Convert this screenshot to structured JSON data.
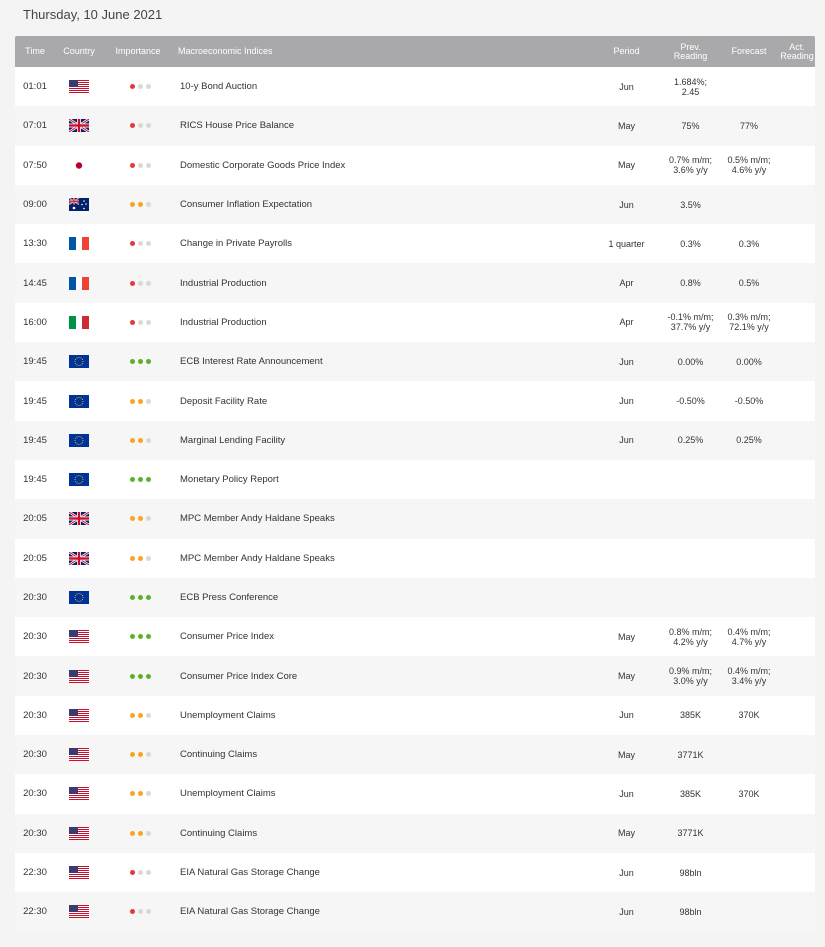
{
  "page": {
    "date": "Thursday, 10 June 2021"
  },
  "colors": {
    "high": "#5cb12c",
    "medium": "#f5a623",
    "low": "#e03a3a",
    "inactive": "#d8d8d8",
    "header_bg": "#a9a9ab"
  },
  "header": {
    "time": "Time",
    "country": "Country",
    "importance": "Importance",
    "indices": "Macroeconomic Indices",
    "period": "Period",
    "prev_1": "Prev.",
    "prev_2": "Reading",
    "forecast": "Forecast",
    "act_1": "Act.",
    "act_2": "Reading"
  },
  "rows": [
    {
      "time": "01:01",
      "country": "us",
      "importance": "low",
      "name": "10-y Bond Auction",
      "period": "Jun",
      "prev": [
        "1.684%;",
        "2.45"
      ],
      "forecast": [],
      "actual": ""
    },
    {
      "time": "07:01",
      "country": "gb",
      "importance": "low",
      "name": "RICS House Price Balance",
      "period": "May",
      "prev": [
        "75%"
      ],
      "forecast": [
        "77%"
      ],
      "actual": ""
    },
    {
      "time": "07:50",
      "country": "jp",
      "importance": "low",
      "name": "Domestic Corporate Goods Price Index",
      "period": "May",
      "prev": [
        "0.7% m/m;",
        "3.6% y/y"
      ],
      "forecast": [
        "0.5% m/m;",
        "4.6% y/y"
      ],
      "actual": ""
    },
    {
      "time": "09:00",
      "country": "au",
      "importance": "medium",
      "name": "Consumer Inflation Expectation",
      "period": "Jun",
      "prev": [
        "3.5%"
      ],
      "forecast": [],
      "actual": ""
    },
    {
      "time": "13:30",
      "country": "fr",
      "importance": "low",
      "name": "Change in Private Payrolls",
      "period": "1 quarter",
      "prev": [
        "0.3%"
      ],
      "forecast": [
        "0.3%"
      ],
      "actual": ""
    },
    {
      "time": "14:45",
      "country": "fr",
      "importance": "low",
      "name": "Industrial Production",
      "period": "Apr",
      "prev": [
        "0.8%"
      ],
      "forecast": [
        "0.5%"
      ],
      "actual": ""
    },
    {
      "time": "16:00",
      "country": "it",
      "importance": "low",
      "name": "Industrial Production",
      "period": "Apr",
      "prev": [
        "-0.1% m/m;",
        "37.7% y/y"
      ],
      "forecast": [
        "0.3% m/m;",
        "72.1% y/y"
      ],
      "actual": ""
    },
    {
      "time": "19:45",
      "country": "eu",
      "importance": "high",
      "name": "ECB Interest Rate Announcement",
      "period": "Jun",
      "prev": [
        "0.00%"
      ],
      "forecast": [
        "0.00%"
      ],
      "actual": ""
    },
    {
      "time": "19:45",
      "country": "eu",
      "importance": "medium",
      "name": "Deposit Facility Rate",
      "period": "Jun",
      "prev": [
        "-0.50%"
      ],
      "forecast": [
        "-0.50%"
      ],
      "actual": ""
    },
    {
      "time": "19:45",
      "country": "eu",
      "importance": "medium",
      "name": "Marginal Lending Facility",
      "period": "Jun",
      "prev": [
        "0.25%"
      ],
      "forecast": [
        "0.25%"
      ],
      "actual": ""
    },
    {
      "time": "19:45",
      "country": "eu",
      "importance": "high",
      "name": "Monetary Policy Report",
      "period": "",
      "prev": [],
      "forecast": [],
      "actual": ""
    },
    {
      "time": "20:05",
      "country": "gb",
      "importance": "medium",
      "name": "MPC Member Andy Haldane Speaks",
      "period": "",
      "prev": [],
      "forecast": [],
      "actual": ""
    },
    {
      "time": "20:05",
      "country": "gb",
      "importance": "medium",
      "name": "MPC Member Andy Haldane Speaks",
      "period": "",
      "prev": [],
      "forecast": [],
      "actual": ""
    },
    {
      "time": "20:30",
      "country": "eu",
      "importance": "high",
      "name": "ECB Press Conference",
      "period": "",
      "prev": [],
      "forecast": [],
      "actual": ""
    },
    {
      "time": "20:30",
      "country": "us",
      "importance": "high",
      "name": "Consumer Price Index",
      "period": "May",
      "prev": [
        "0.8% m/m;",
        "4.2% y/y"
      ],
      "forecast": [
        "0.4% m/m;",
        "4.7% y/y"
      ],
      "actual": ""
    },
    {
      "time": "20:30",
      "country": "us",
      "importance": "high",
      "name": "Consumer Price Index Core",
      "period": "May",
      "prev": [
        "0.9% m/m;",
        "3.0% y/y"
      ],
      "forecast": [
        "0.4% m/m;",
        "3.4% y/y"
      ],
      "actual": ""
    },
    {
      "time": "20:30",
      "country": "us",
      "importance": "medium",
      "name": "Unemployment Claims",
      "period": "Jun",
      "prev": [
        "385K"
      ],
      "forecast": [
        "370K"
      ],
      "actual": ""
    },
    {
      "time": "20:30",
      "country": "us",
      "importance": "medium",
      "name": "Continuing Claims",
      "period": "May",
      "prev": [
        "3771K"
      ],
      "forecast": [],
      "actual": ""
    },
    {
      "time": "20:30",
      "country": "us",
      "importance": "medium",
      "name": "Unemployment Claims",
      "period": "Jun",
      "prev": [
        "385K"
      ],
      "forecast": [
        "370K"
      ],
      "actual": ""
    },
    {
      "time": "20:30",
      "country": "us",
      "importance": "medium",
      "name": "Continuing Claims",
      "period": "May",
      "prev": [
        "3771K"
      ],
      "forecast": [],
      "actual": ""
    },
    {
      "time": "22:30",
      "country": "us",
      "importance": "low",
      "name": "EIA Natural Gas Storage Change",
      "period": "Jun",
      "prev": [
        "98bln"
      ],
      "forecast": [],
      "actual": ""
    },
    {
      "time": "22:30",
      "country": "us",
      "importance": "low",
      "name": "EIA Natural Gas Storage Change",
      "period": "Jun",
      "prev": [
        "98bln"
      ],
      "forecast": [],
      "actual": ""
    }
  ]
}
